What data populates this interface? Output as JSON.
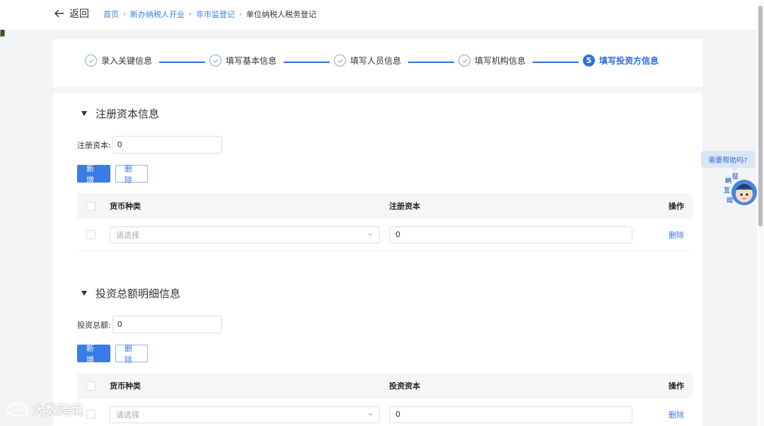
{
  "header": {
    "back_label": "返回",
    "breadcrumbs": [
      "首页",
      "新办纳税人开业",
      "非市监登记"
    ],
    "current": "单位纳税人税务登记"
  },
  "steps": [
    {
      "label": "录入关键信息",
      "state": "done"
    },
    {
      "label": "填写基本信息",
      "state": "done"
    },
    {
      "label": "填写人员信息",
      "state": "done"
    },
    {
      "label": "填写机构信息",
      "state": "done"
    },
    {
      "label": "填写投资方信息",
      "state": "active",
      "number": "5"
    }
  ],
  "section1": {
    "title": "注册资本信息",
    "field_label": "注册资本:",
    "field_value": "0",
    "add_label": "新增",
    "delete_label": "删除",
    "table": {
      "headers": [
        "货币种类",
        "注册资本",
        "操作"
      ],
      "rows": [
        {
          "select_placeholder": "请选择",
          "value": "0",
          "action": "删除"
        }
      ]
    }
  },
  "section2": {
    "title": "投资总额明细信息",
    "field_label": "投资总额:",
    "field_value": "0",
    "add_label": "新增",
    "delete_label": "删除",
    "table": {
      "headers": [
        "货币种类",
        "投资资本",
        "操作"
      ],
      "rows": [
        {
          "select_placeholder": "请选择",
          "value": "0",
          "action": "删除"
        }
      ]
    }
  },
  "help": {
    "text": "需要帮助吗?",
    "mascot_chars": [
      "征",
      "纳",
      "互",
      "动"
    ]
  },
  "watermark": "大数跨境",
  "colors": {
    "accent": "#3b7be8",
    "step_active": "#2f6fd6"
  }
}
